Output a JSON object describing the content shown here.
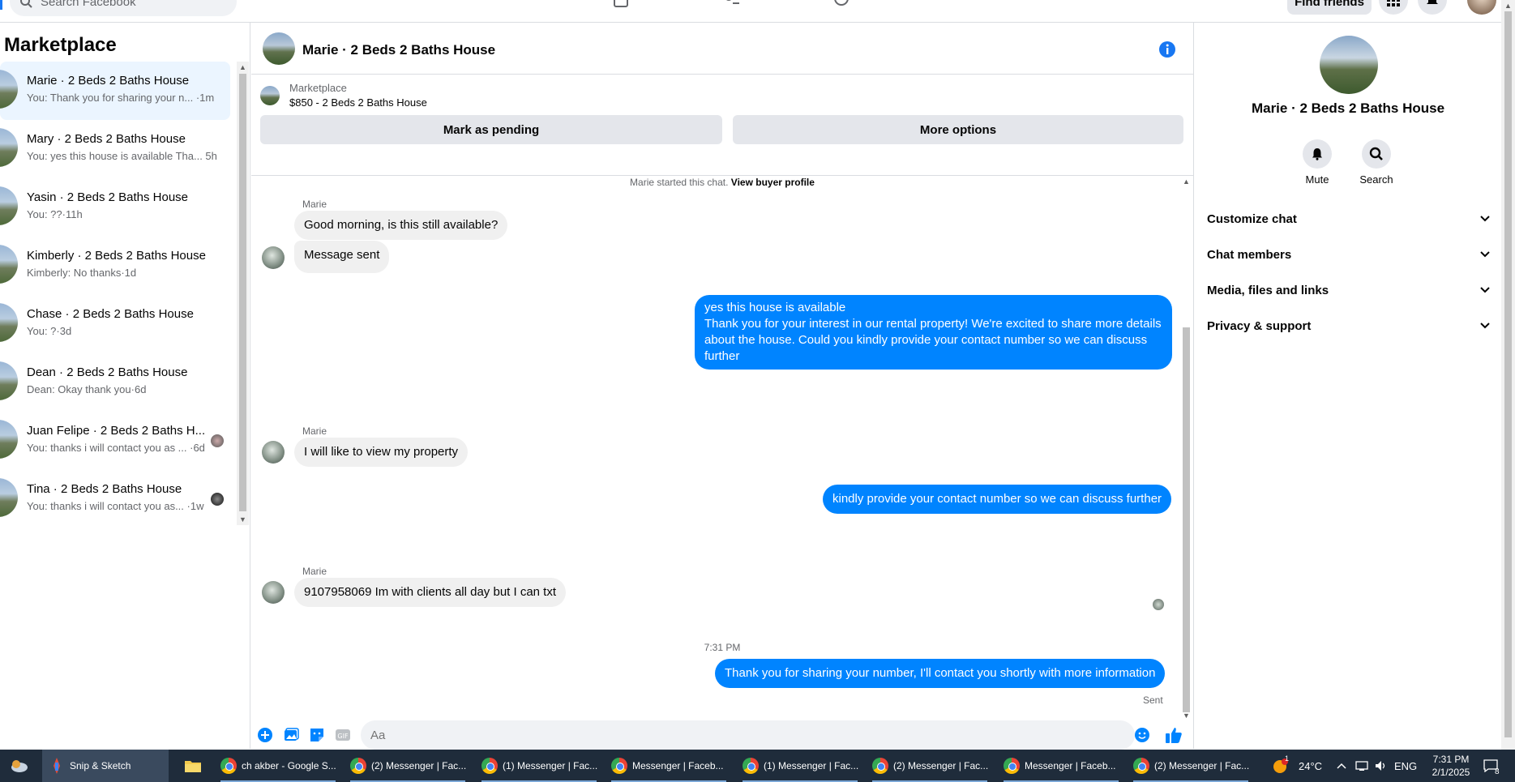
{
  "topnav": {
    "search_placeholder": "Search Facebook",
    "find_friends": "Find friends"
  },
  "left": {
    "title": "Marketplace",
    "conversations": [
      {
        "name": "Marie · 2 Beds 2 Baths House",
        "snippet": "You: Thank you for sharing your n... ·1m",
        "active": true
      },
      {
        "name": "Mary · 2 Beds 2 Baths House",
        "snippet": "You: yes this house is available Tha... 5h"
      },
      {
        "name": "Yasin · 2 Beds 2 Baths House",
        "snippet": "You: ??·11h"
      },
      {
        "name": "Kimberly · 2 Beds 2 Baths House",
        "snippet": "Kimberly: No thanks·1d"
      },
      {
        "name": "Chase · 2 Beds 2 Baths House",
        "snippet": "You: ?·3d"
      },
      {
        "name": "Dean · 2 Beds 2 Baths House",
        "snippet": "Dean: Okay thank you·6d"
      },
      {
        "name": "Juan Felipe · 2 Beds 2 Baths H...",
        "snippet": "You: thanks i will contact you as ... ·6d"
      },
      {
        "name": "Tina · 2 Beds 2 Baths House",
        "snippet": "You: thanks i will contact you as... ·1w"
      }
    ]
  },
  "chat": {
    "title": "Marie · 2 Beds 2 Baths House",
    "marketplace_label": "Marketplace",
    "listing": "$850 - 2 Beds 2 Baths House",
    "mark_pending": "Mark as pending",
    "more_options": "More options",
    "started_text": "Marie started this chat.",
    "view_buyer": "View buyer profile",
    "sender_name": "Marie",
    "messages": {
      "m1": "Good morning, is this still available?",
      "m2": "Message sent",
      "m3": "yes this house is available\nThank you for your interest in our rental property! We're excited to share more details about the house. Could you kindly provide your contact number so we can discuss further",
      "m4": "I will like to view my property",
      "m5": "kindly provide your contact number so we can discuss further",
      "m6": "9107958069 Im with clients all day but I can txt",
      "m7": "Thank you for sharing your number, I'll contact you shortly with more information"
    },
    "timestamp": "7:31 PM",
    "sent_status": "Sent",
    "composer_placeholder": "Aa"
  },
  "right": {
    "name": "Marie · 2 Beds 2 Baths House",
    "mute": "Mute",
    "search": "Search",
    "sections": [
      "Customize chat",
      "Chat members",
      "Media, files and links",
      "Privacy & support"
    ]
  },
  "taskbar": {
    "snip": "Snip & Sketch",
    "items": [
      "ch akber - Google S...",
      "(2) Messenger | Fac...",
      "(1) Messenger | Fac...",
      "Messenger | Faceb...",
      "(1) Messenger | Fac...",
      "(2) Messenger | Fac...",
      "Messenger | Faceb...",
      "(2) Messenger | Fac..."
    ],
    "weather": "24°C",
    "lang": "ENG",
    "time": "7:31 PM",
    "date": "2/1/2025",
    "notif_count": "8",
    "weather_badge": "1"
  },
  "colors": {
    "accent": "#1877f2",
    "outgoing_bubble": "#0084ff",
    "incoming_bubble": "#f0f0f0",
    "active_row": "#ebf5ff"
  }
}
